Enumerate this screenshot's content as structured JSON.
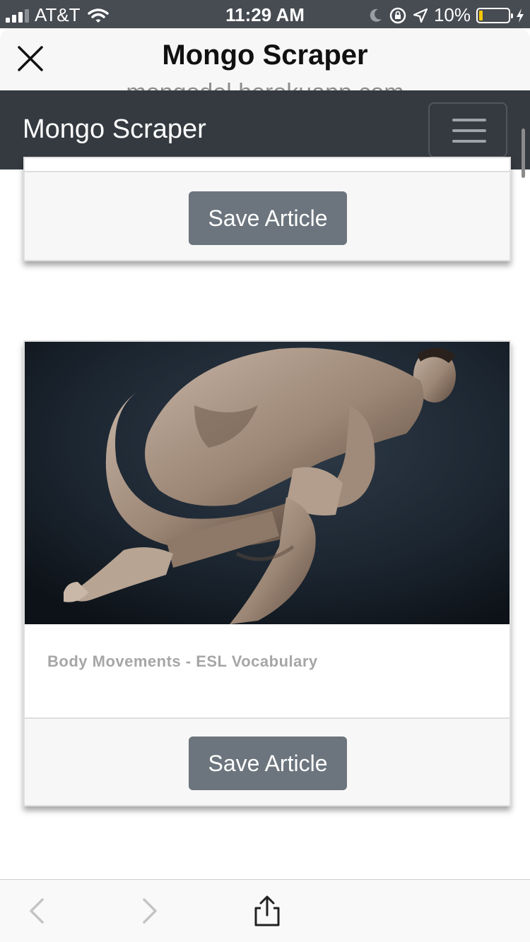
{
  "status_bar": {
    "carrier": "AT&T",
    "time": "11:29 AM",
    "battery_percent": "10%"
  },
  "sheet": {
    "title": "Mongo Scraper",
    "subtitle": "mongodel.herokuapp.com"
  },
  "navbar": {
    "brand": "Mongo Scraper"
  },
  "articles": [
    {
      "title": "",
      "save_label": "Save Article"
    },
    {
      "title": "Body Movements - ESL Vocabulary",
      "image_description": "man-crouching-photo",
      "save_label": "Save Article"
    }
  ],
  "colors": {
    "navbar_bg": "#343a40",
    "button_bg": "#6c757d",
    "status_bar_bg": "#474b52",
    "battery_level": "#f7c800"
  },
  "icons": {
    "close": "close-icon",
    "menu": "hamburger-icon",
    "back": "chevron-left-icon",
    "forward": "chevron-right-icon",
    "share": "share-icon"
  }
}
